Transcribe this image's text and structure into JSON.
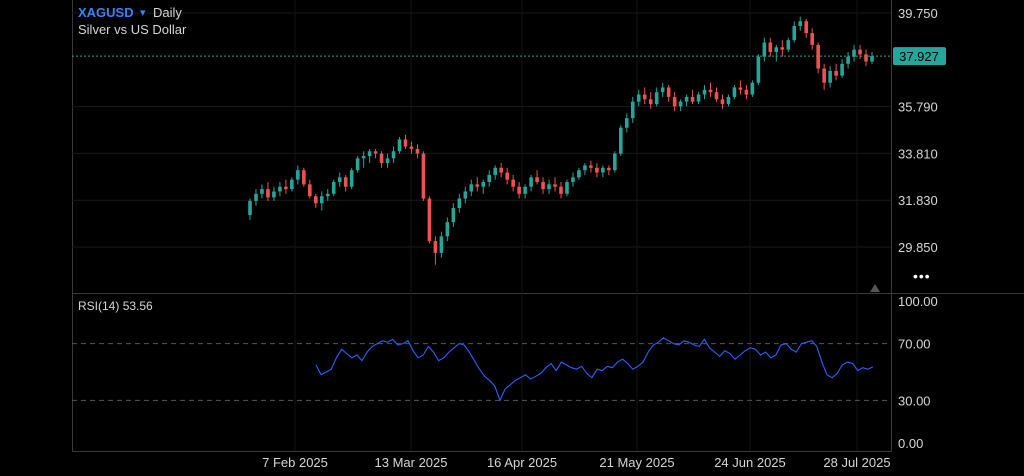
{
  "header": {
    "symbol": "XAGUSD",
    "dropdown_icon": "triangle-down-icon",
    "timeframe": "Daily",
    "description": "Silver vs US Dollar"
  },
  "price_axis": {
    "ticks": [
      "39.750",
      "35.790",
      "33.810",
      "31.830",
      "29.850"
    ],
    "last_price": "37.927"
  },
  "rsi": {
    "label": "RSI(14)",
    "value": "53.56",
    "ticks": [
      "100.00",
      "70.00",
      "30.00",
      "0.00"
    ]
  },
  "time_axis": {
    "labels": [
      "7 Feb 2025",
      "13 Mar 2025",
      "16 Apr 2025",
      "21 May 2025",
      "24 Jun 2025",
      "28 Jul 2025"
    ]
  },
  "more_icon": "more-dots-icon",
  "colors": {
    "up": "#26a69a",
    "down": "#ef5350",
    "rsi_line": "#2962ff",
    "price_badge": "#26a69a"
  },
  "chart_data": [
    {
      "type": "candlestick",
      "title": "XAGUSD Daily",
      "ylim": [
        28.5,
        40.5
      ],
      "yticks": [
        39.75,
        35.79,
        33.81,
        31.83,
        29.85
      ],
      "xticks": [
        "7 Feb 2025",
        "13 Mar 2025",
        "16 Apr 2025",
        "21 May 2025",
        "24 Jun 2025",
        "28 Jul 2025"
      ],
      "last_price": 37.927,
      "candles": [
        [
          31.2,
          31.9,
          31.0,
          31.8
        ],
        [
          31.8,
          32.3,
          31.6,
          32.1
        ],
        [
          32.1,
          32.5,
          31.9,
          32.3
        ],
        [
          32.3,
          32.6,
          31.8,
          31.95
        ],
        [
          31.95,
          32.4,
          31.8,
          32.2
        ],
        [
          32.2,
          32.6,
          32.0,
          32.4
        ],
        [
          32.4,
          32.7,
          32.1,
          32.3
        ],
        [
          32.3,
          32.8,
          32.2,
          32.7
        ],
        [
          32.7,
          33.3,
          32.5,
          33.1
        ],
        [
          33.1,
          33.2,
          32.4,
          32.5
        ],
        [
          32.5,
          32.7,
          31.9,
          32.0
        ],
        [
          32.0,
          32.1,
          31.5,
          31.7
        ],
        [
          31.7,
          32.2,
          31.4,
          32.0
        ],
        [
          32.0,
          32.3,
          31.8,
          32.1
        ],
        [
          32.1,
          32.7,
          32.0,
          32.6
        ],
        [
          32.6,
          33.0,
          32.4,
          32.8
        ],
        [
          32.8,
          32.9,
          32.2,
          32.4
        ],
        [
          32.4,
          33.2,
          32.3,
          33.1
        ],
        [
          33.1,
          33.7,
          33.0,
          33.6
        ],
        [
          33.6,
          33.9,
          33.2,
          33.7
        ],
        [
          33.7,
          34.0,
          33.4,
          33.9
        ],
        [
          33.9,
          34.0,
          33.6,
          33.8
        ],
        [
          33.8,
          33.9,
          33.2,
          33.4
        ],
        [
          33.4,
          33.8,
          33.2,
          33.6
        ],
        [
          33.6,
          34.1,
          33.4,
          33.9
        ],
        [
          33.9,
          34.5,
          33.8,
          34.4
        ],
        [
          34.4,
          34.6,
          34.0,
          34.1
        ],
        [
          34.1,
          34.3,
          33.8,
          34.0
        ],
        [
          34.0,
          34.2,
          33.6,
          33.8
        ],
        [
          33.8,
          33.9,
          31.8,
          31.9
        ],
        [
          31.9,
          32.0,
          30.0,
          30.1
        ],
        [
          30.1,
          30.3,
          29.1,
          29.6
        ],
        [
          29.6,
          30.5,
          29.4,
          30.3
        ],
        [
          30.3,
          31.1,
          30.1,
          30.9
        ],
        [
          30.9,
          31.7,
          30.7,
          31.5
        ],
        [
          31.5,
          32.1,
          31.3,
          31.9
        ],
        [
          31.9,
          32.4,
          31.7,
          32.2
        ],
        [
          32.2,
          32.7,
          32.0,
          32.5
        ],
        [
          32.5,
          32.8,
          32.2,
          32.4
        ],
        [
          32.4,
          32.7,
          32.1,
          32.6
        ],
        [
          32.6,
          33.1,
          32.4,
          32.9
        ],
        [
          32.9,
          33.3,
          32.7,
          33.2
        ],
        [
          33.2,
          33.4,
          32.8,
          33.0
        ],
        [
          33.0,
          33.2,
          32.5,
          32.7
        ],
        [
          32.7,
          32.9,
          32.2,
          32.4
        ],
        [
          32.4,
          32.6,
          31.9,
          32.1
        ],
        [
          32.1,
          32.5,
          31.9,
          32.4
        ],
        [
          32.4,
          32.9,
          32.2,
          32.8
        ],
        [
          32.8,
          33.1,
          32.5,
          32.6
        ],
        [
          32.6,
          32.8,
          32.1,
          32.3
        ],
        [
          32.3,
          32.7,
          32.1,
          32.5
        ],
        [
          32.5,
          32.8,
          32.2,
          32.4
        ],
        [
          32.4,
          32.6,
          31.9,
          32.1
        ],
        [
          32.1,
          32.7,
          32.0,
          32.6
        ],
        [
          32.6,
          33.0,
          32.4,
          32.8
        ],
        [
          32.8,
          33.2,
          32.7,
          33.1
        ],
        [
          33.1,
          33.4,
          32.9,
          33.3
        ],
        [
          33.3,
          33.5,
          33.0,
          33.2
        ],
        [
          33.2,
          33.4,
          32.8,
          33.0
        ],
        [
          33.0,
          33.3,
          32.8,
          33.2
        ],
        [
          33.2,
          33.3,
          32.9,
          33.1
        ],
        [
          33.1,
          33.9,
          33.0,
          33.8
        ],
        [
          33.8,
          35.0,
          33.7,
          34.9
        ],
        [
          34.9,
          35.5,
          34.7,
          35.3
        ],
        [
          35.3,
          36.2,
          35.1,
          36.0
        ],
        [
          36.0,
          36.5,
          35.8,
          36.3
        ],
        [
          36.3,
          36.6,
          35.9,
          36.1
        ],
        [
          36.1,
          36.4,
          35.7,
          35.9
        ],
        [
          35.9,
          36.6,
          35.8,
          36.4
        ],
        [
          36.4,
          36.8,
          36.2,
          36.6
        ],
        [
          36.6,
          36.7,
          36.0,
          36.2
        ],
        [
          36.2,
          36.4,
          35.6,
          35.8
        ],
        [
          35.8,
          36.1,
          35.6,
          36.0
        ],
        [
          36.0,
          36.3,
          35.8,
          36.2
        ],
        [
          36.2,
          36.5,
          35.9,
          36.0
        ],
        [
          36.0,
          36.4,
          35.9,
          36.3
        ],
        [
          36.3,
          36.7,
          36.1,
          36.5
        ],
        [
          36.5,
          36.8,
          36.2,
          36.4
        ],
        [
          36.4,
          36.6,
          36.0,
          36.1
        ],
        [
          36.1,
          36.3,
          35.7,
          35.9
        ],
        [
          35.9,
          36.3,
          35.8,
          36.2
        ],
        [
          36.2,
          36.7,
          36.1,
          36.6
        ],
        [
          36.6,
          36.9,
          36.3,
          36.5
        ],
        [
          36.5,
          36.7,
          36.1,
          36.3
        ],
        [
          36.3,
          36.9,
          36.2,
          36.8
        ],
        [
          36.8,
          38.0,
          36.7,
          37.9
        ],
        [
          37.9,
          38.7,
          37.7,
          38.5
        ],
        [
          38.5,
          38.7,
          37.9,
          38.1
        ],
        [
          38.1,
          38.4,
          37.7,
          38.3
        ],
        [
          38.3,
          38.6,
          37.9,
          38.2
        ],
        [
          38.2,
          38.7,
          38.1,
          38.6
        ],
        [
          38.6,
          39.4,
          38.5,
          39.2
        ],
        [
          39.2,
          39.6,
          39.0,
          39.4
        ],
        [
          39.4,
          39.5,
          38.7,
          38.9
        ],
        [
          38.9,
          39.1,
          38.2,
          38.4
        ],
        [
          38.4,
          38.5,
          37.2,
          37.4
        ],
        [
          37.4,
          37.6,
          36.5,
          36.8
        ],
        [
          36.8,
          37.5,
          36.6,
          37.3
        ],
        [
          37.3,
          37.6,
          36.9,
          37.1
        ],
        [
          37.1,
          37.8,
          37.0,
          37.6
        ],
        [
          37.6,
          38.1,
          37.4,
          37.9
        ],
        [
          37.9,
          38.4,
          37.7,
          38.2
        ],
        [
          38.2,
          38.4,
          37.8,
          38.0
        ],
        [
          38.0,
          38.2,
          37.5,
          37.7
        ],
        [
          37.7,
          38.1,
          37.6,
          37.927
        ]
      ]
    },
    {
      "type": "line",
      "title": "RSI(14)",
      "ylim": [
        0,
        100
      ],
      "yticks": [
        100,
        70,
        30,
        0
      ],
      "reference_lines": [
        70,
        30
      ],
      "series": [
        {
          "name": "RSI(14)",
          "values": [
            55,
            48,
            50,
            52,
            60,
            66,
            63,
            60,
            62,
            58,
            64,
            68,
            70,
            72,
            71,
            73,
            69,
            70,
            72,
            65,
            60,
            62,
            68,
            64,
            58,
            60,
            64,
            67,
            70,
            69,
            64,
            58,
            52,
            47,
            44,
            40,
            30,
            38,
            41,
            44,
            46,
            48,
            45,
            47,
            49,
            53,
            56,
            51,
            57,
            55,
            53,
            52,
            54,
            49,
            46,
            52,
            51,
            54,
            53,
            57,
            59,
            56,
            52,
            54,
            57,
            64,
            69,
            71,
            74,
            72,
            70,
            69,
            72,
            71,
            69,
            68,
            73,
            67,
            64,
            61,
            65,
            63,
            59,
            62,
            65,
            67,
            66,
            62,
            64,
            60,
            62,
            69,
            70,
            66,
            64,
            70,
            71,
            72,
            68,
            57,
            48,
            46,
            49,
            55,
            57,
            56,
            51,
            53,
            52,
            53.56
          ]
        }
      ]
    }
  ]
}
